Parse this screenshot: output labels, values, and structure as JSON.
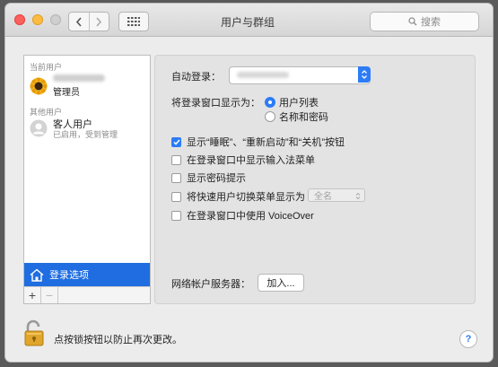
{
  "window": {
    "title": "用户与群组"
  },
  "search": {
    "placeholder": "搜索",
    "icon": "search-icon"
  },
  "sidebar": {
    "current_label": "当前用户",
    "current_user": {
      "role": "管理员"
    },
    "other_label": "其他用户",
    "guest": {
      "name": "客人用户",
      "status": "已启用，受到管理"
    },
    "login_options": "登录选项",
    "add_symbol": "+",
    "remove_symbol": "−"
  },
  "panel": {
    "auto_login_label": "自动登录：",
    "display_label": "将登录窗口显示为：",
    "radio_options": [
      {
        "label": "用户列表",
        "selected": true
      },
      {
        "label": "名称和密码",
        "selected": false
      }
    ],
    "checkboxes": [
      {
        "label": "显示“睡眠”、“重新启动”和“关机”按钮",
        "checked": true
      },
      {
        "label": "在登录窗口中显示输入法菜单",
        "checked": false
      },
      {
        "label": "显示密码提示",
        "checked": false
      },
      {
        "label": "将快速用户切换菜单显示为",
        "checked": false
      },
      {
        "label": "在登录窗口中使用 VoiceOver",
        "checked": false
      }
    ],
    "fast_switch_value": "全名",
    "network_label": "网络帐户服务器：",
    "join_button": "加入..."
  },
  "footer": {
    "lock_text": "点按锁按钮以防止再次更改。",
    "help": "?"
  },
  "colors": {
    "accent": "#2c7cf6",
    "selection": "#1f6de0"
  }
}
